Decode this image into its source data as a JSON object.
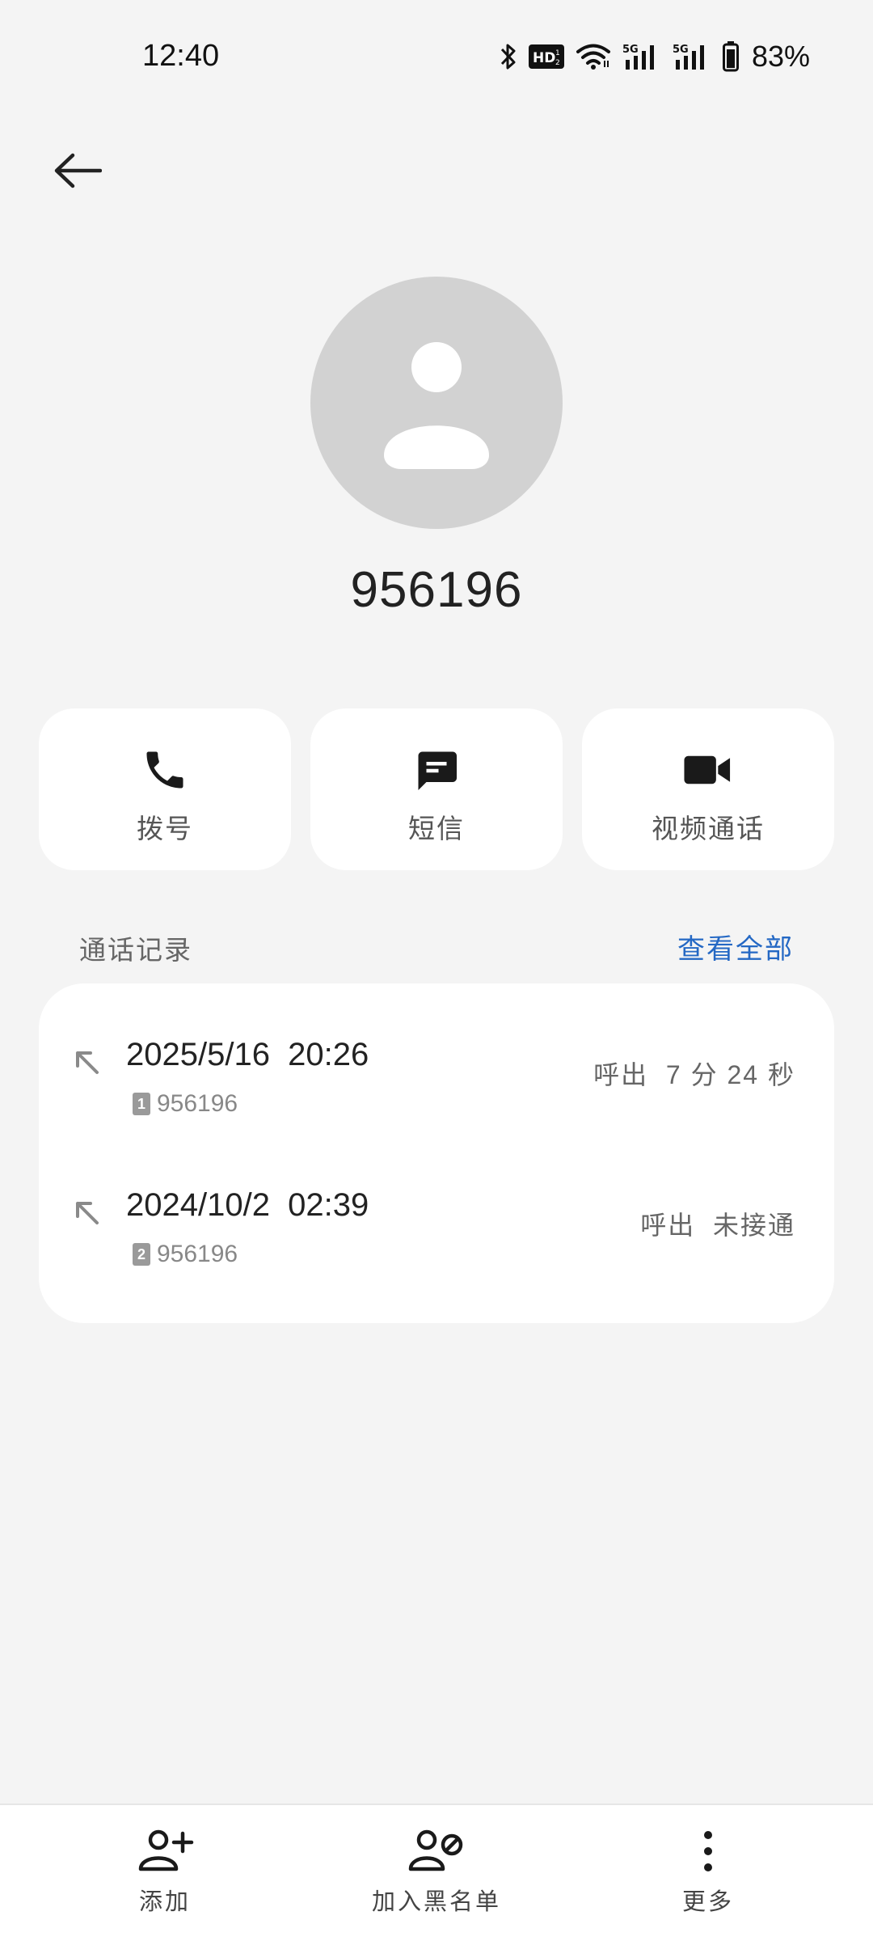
{
  "status_bar": {
    "time": "12:40",
    "battery_percent": "83%",
    "icons": [
      "bluetooth-icon",
      "hd-icon",
      "wifi-icon",
      "signal-5g-icon",
      "signal-5g-icon",
      "battery-icon"
    ]
  },
  "header": {
    "back_icon": "arrow-left-icon"
  },
  "contact": {
    "name": "956196",
    "avatar_icon": "person-icon"
  },
  "actions": [
    {
      "label": "拨号",
      "icon": "phone-icon"
    },
    {
      "label": "短信",
      "icon": "message-icon"
    },
    {
      "label": "视频通话",
      "icon": "video-camera-icon"
    }
  ],
  "call_log": {
    "title": "通话记录",
    "view_all": "查看全部",
    "entries": [
      {
        "datetime": "2025/5/16  20:26",
        "sim": "1",
        "number": "956196",
        "result": "呼出  7 分 24 秒",
        "icon": "outgoing-call-icon"
      },
      {
        "datetime": "2024/10/2  02:39",
        "sim": "2",
        "number": "956196",
        "result": "呼出  未接通",
        "icon": "outgoing-call-icon"
      }
    ]
  },
  "bottom_bar": [
    {
      "label": "添加",
      "icon": "add-contact-icon"
    },
    {
      "label": "加入黑名单",
      "icon": "block-contact-icon"
    },
    {
      "label": "更多",
      "icon": "more-vertical-icon"
    }
  ],
  "colors": {
    "accent": "#2468c4",
    "background": "#f4f4f4",
    "card": "#ffffff",
    "avatar_bg": "#d2d2d2"
  }
}
